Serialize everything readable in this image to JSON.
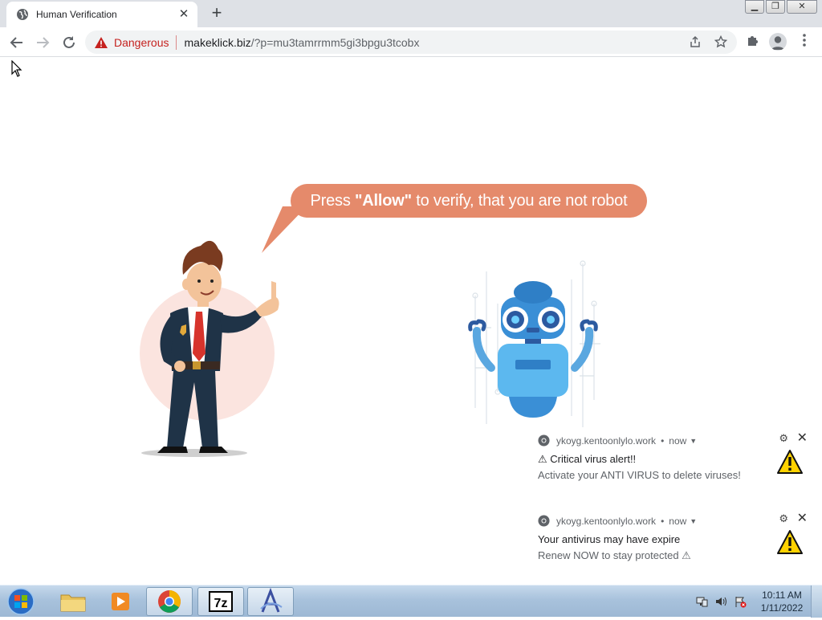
{
  "browser": {
    "tab_title": "Human Verification",
    "security_label": "Dangerous",
    "url_host": "makeklick.biz",
    "url_rest": "/?p=mu3tamrrmm5gi3bpgu3tcobx"
  },
  "page": {
    "bubble_pre": "Press ",
    "bubble_bold": "\"Allow\"",
    "bubble_post": " to verify, that you are not robot"
  },
  "notifications": [
    {
      "source": "ykoyg.kentoonlylo.work",
      "time": "now",
      "title": "⚠ Critical virus alert!!",
      "body": "Activate your ANTI VIRUS to delete viruses!"
    },
    {
      "source": "ykoyg.kentoonlylo.work",
      "time": "now",
      "title": "Your antivirus may have expire",
      "body": "Renew NOW to stay protected ⚠"
    }
  ],
  "taskbar": {
    "time": "10:11 AM",
    "date": "1/11/2022"
  },
  "colors": {
    "bubble": "#e58a6b",
    "danger": "#c5221f"
  }
}
